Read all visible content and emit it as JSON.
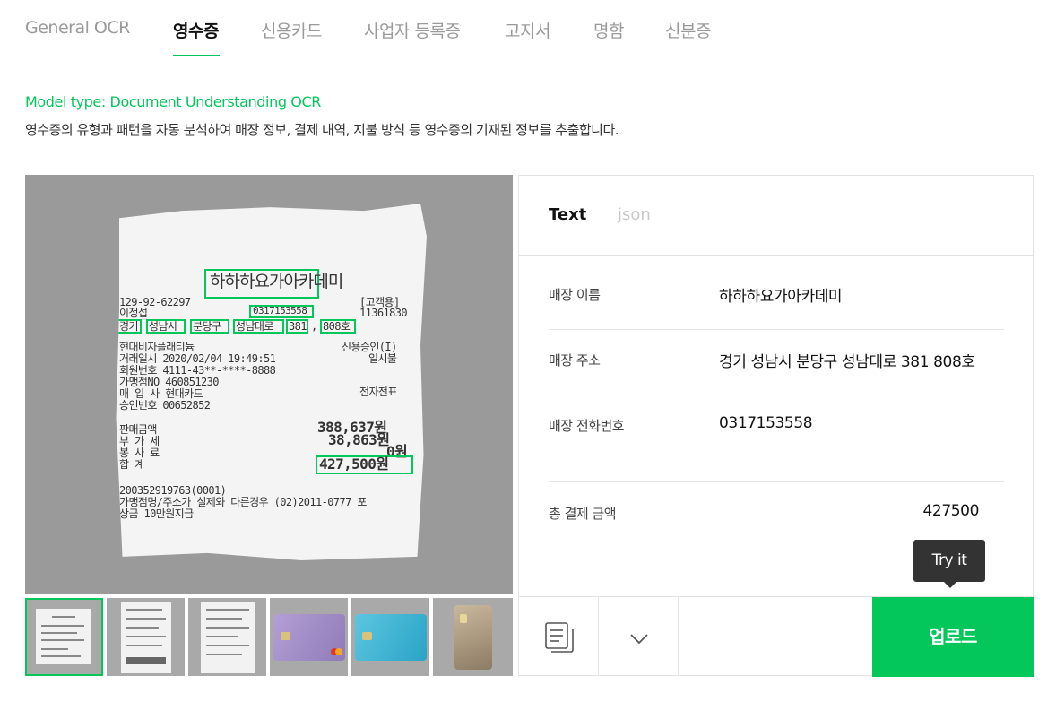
{
  "tabs": [
    {
      "label": "General OCR"
    },
    {
      "label": "영수증"
    },
    {
      "label": "신용카드"
    },
    {
      "label": "사업자 등록증"
    },
    {
      "label": "고지서"
    },
    {
      "label": "명함"
    },
    {
      "label": "신분증"
    }
  ],
  "active_tab": "영수증",
  "model_type": "Model type: Document Understanding OCR",
  "description": "영수증의 유형과 패턴을 자동 분석하여 매장 정보, 결제 내역, 지불 방식 등 영수증의 기재된 정보를 추출합니다.",
  "receipt": {
    "store_name": "하하하요가아카데미",
    "biz_no": "129-92-62297",
    "owner": "이정섭",
    "copy_type": "[고객용]",
    "number": "11361830",
    "phone": "0317153558",
    "addr_parts": [
      "경기",
      "성남시",
      "분당구",
      "성남대로",
      "381",
      ",",
      "808호"
    ],
    "card_name": "현대비자플래티늄",
    "approval": "신용승인(I)",
    "date_line": "거래일시 2020/02/04 19:49:51",
    "installment": "일시불",
    "card_line": "회원번호 4111-43**-****-8888",
    "merchant_line": "가맹점NO 460851230",
    "issuer_line": "매 입 사 현대카드",
    "slip": "전자전표",
    "approval_line": "승인번호 00652852",
    "sales_label": "판매금액",
    "sales_value": "388,637원",
    "tax_label": "부 가 세",
    "tax_value": "38,863원",
    "service_label": "봉 사 료",
    "service_value": "0원",
    "total_label": "합    계",
    "total_value": "427,500원",
    "footer1": "200352919763(0001)",
    "footer2": "가맹점명/주소가 실제와 다른경우 (02)2011-0777 포",
    "footer3": "상금 10만원지급"
  },
  "result_tabs": [
    {
      "label": "Text"
    },
    {
      "label": "json"
    }
  ],
  "fields": [
    {
      "key": "매장 이름",
      "value": "하하하요가아카데미"
    },
    {
      "key": "매장 주소",
      "value": "경기 성남시 분당구 성남대로 381 808호"
    },
    {
      "key": "매장 전화번호",
      "value": "0317153558"
    },
    {
      "key": "총 결제 금액",
      "value": "427500"
    }
  ],
  "tooltip": "Try it",
  "upload_label": "업로드",
  "icons": {
    "copy": "copy-icon",
    "dropdown": "chevron-down-icon"
  },
  "colors": {
    "accent": "#03c75a",
    "tooltip_bg": "#333333"
  }
}
